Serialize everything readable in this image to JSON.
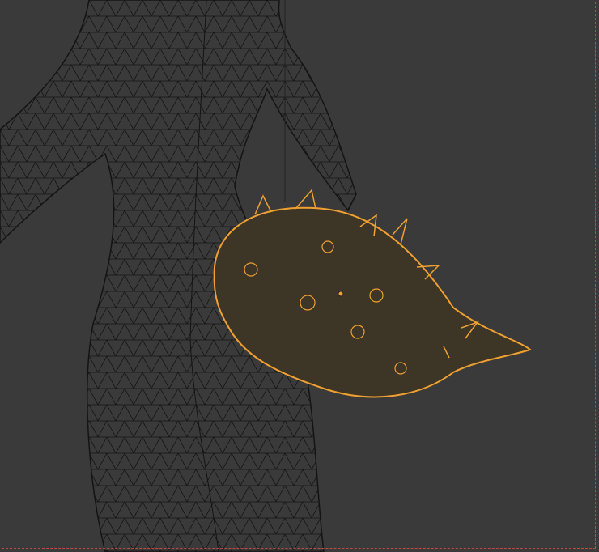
{
  "viewport": {
    "background": "#3a3a3a",
    "wire_color": "#141414",
    "selection_color": "#f0a030",
    "selection_dark": "#c47a1c",
    "border_color": "#c04848"
  }
}
